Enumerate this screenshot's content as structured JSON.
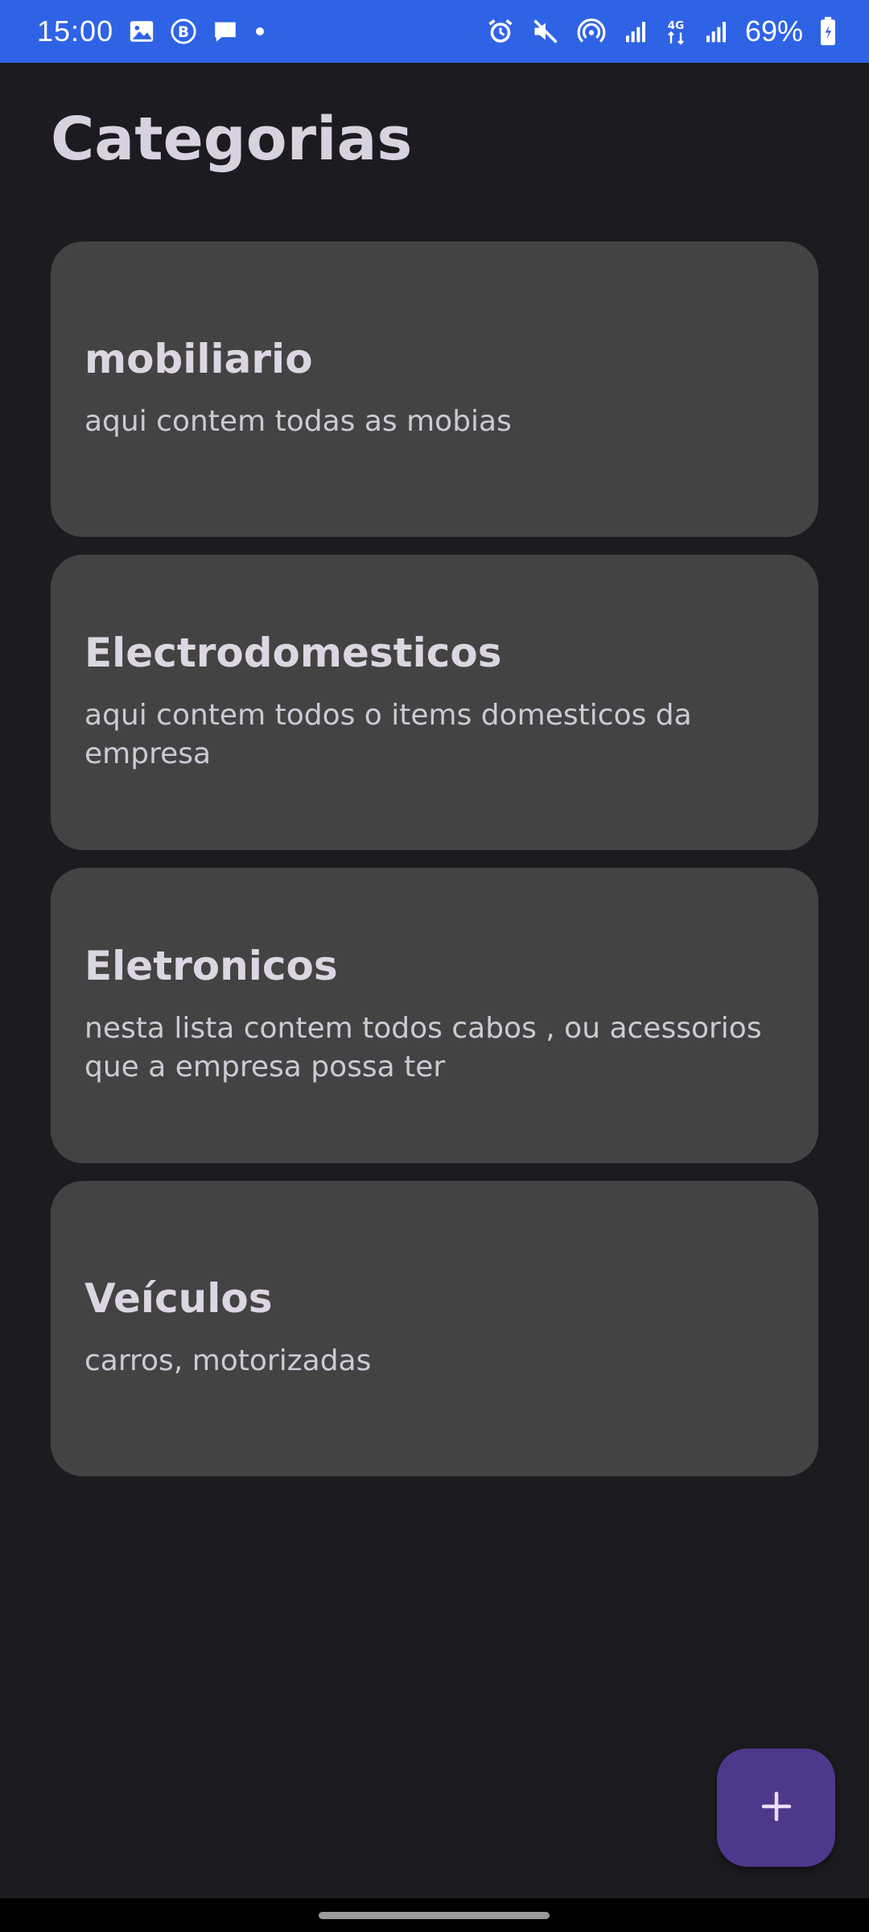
{
  "status_bar": {
    "time": "15:00",
    "battery": "69%",
    "left_icons": [
      "gallery-icon",
      "b-app-icon",
      "message-icon",
      "dot-icon"
    ],
    "right_icons": [
      "alarm-icon",
      "mute-icon",
      "hotspot-icon",
      "signal-icon",
      "4g-signal-icon",
      "signal-icon-2",
      "battery-icon"
    ],
    "color": "#2f63e6"
  },
  "page": {
    "title": "Categorias",
    "background": "#1c1b20"
  },
  "categories": [
    {
      "title": "mobiliario",
      "description": "aqui contem todas as mobias"
    },
    {
      "title": "Electrodomesticos",
      "description": "aqui contem todos o items domesticos da empresa"
    },
    {
      "title": "Eletronicos",
      "description": "nesta lista contem todos cabos , ou acessorios que a empresa possa ter"
    },
    {
      "title": "Veículos",
      "description": "carros, motorizadas"
    }
  ],
  "fab": {
    "icon": "plus-icon",
    "color": "#4f378b"
  }
}
